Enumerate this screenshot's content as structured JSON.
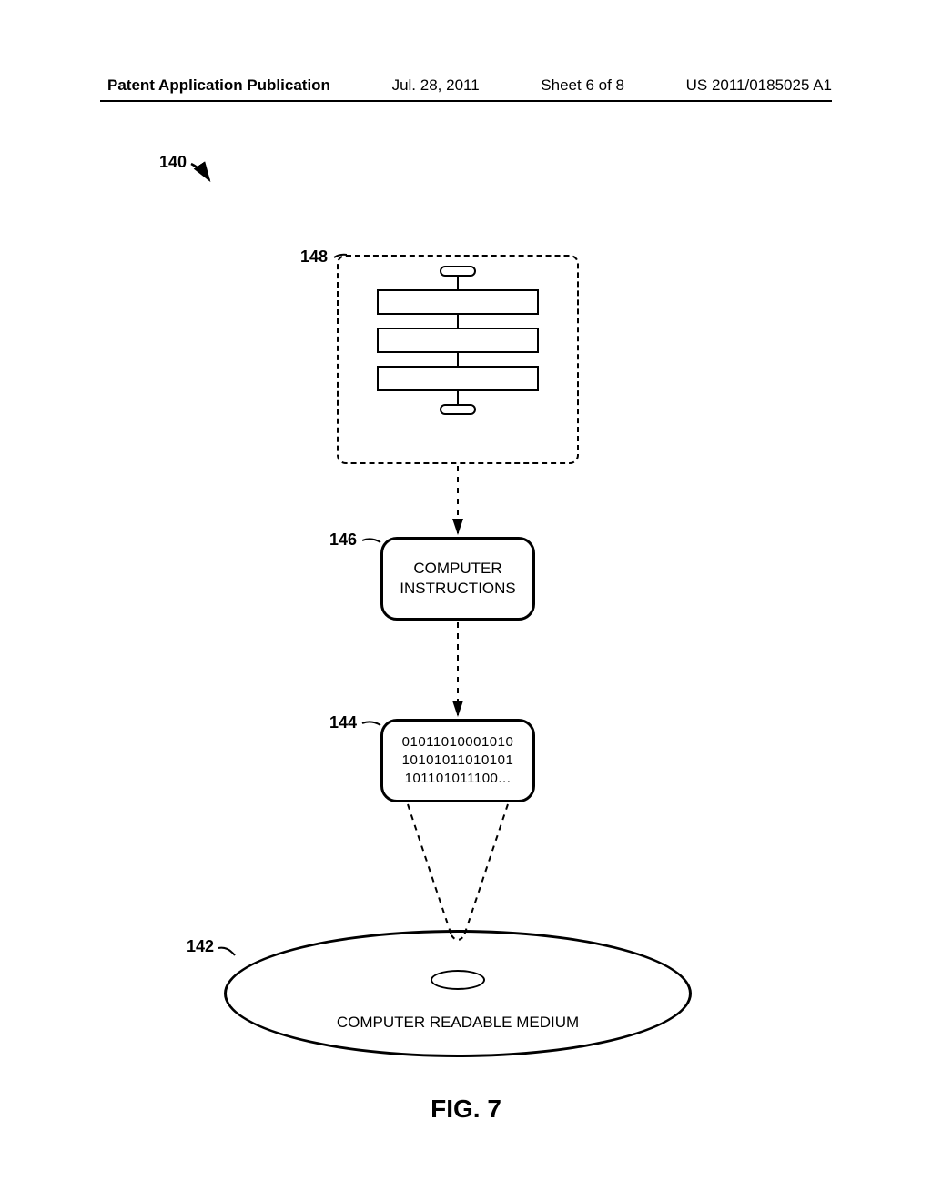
{
  "header": {
    "publication": "Patent Application Publication",
    "date": "Jul. 28, 2011",
    "sheet": "Sheet 6 of 8",
    "pubnum": "US 2011/0185025 A1"
  },
  "refs": {
    "r140": "140",
    "r148": "148",
    "r146": "146",
    "r144": "144",
    "r142": "142"
  },
  "box146": {
    "line1": "COMPUTER",
    "line2": "INSTRUCTIONS"
  },
  "box144": {
    "line1": "01011010001010",
    "line2": "10101011010101",
    "line3": "101101011100..."
  },
  "medium": {
    "label": "COMPUTER READABLE MEDIUM"
  },
  "figure": {
    "caption": "FIG. 7"
  }
}
